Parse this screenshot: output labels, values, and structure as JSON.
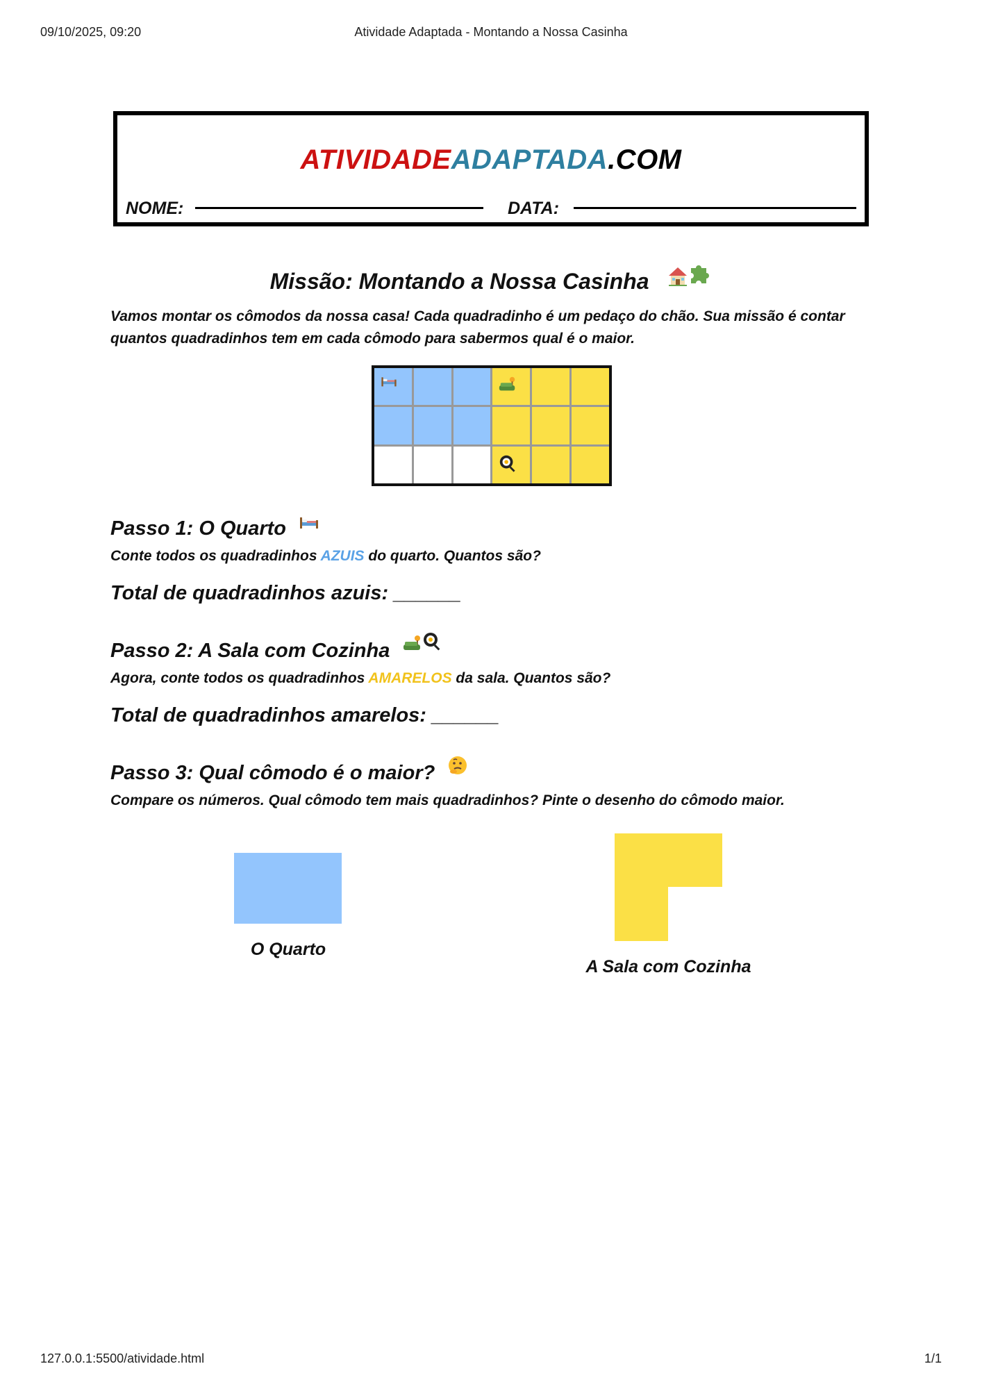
{
  "print_header": {
    "date": "09/10/2025, 09:20",
    "title": "Atividade Adaptada - Montando a Nossa Casinha"
  },
  "print_footer": {
    "url": "127.0.0.1:5500/atividade.html",
    "pages": "1/1"
  },
  "brand": {
    "part1": "ATIVIDADE",
    "part2": "ADAPTADA",
    "part3": ".COM"
  },
  "form": {
    "name_label": "NOME:",
    "date_label": "DATA:"
  },
  "mission": {
    "title": "Missão: Montando a Nossa Casinha",
    "icons": [
      "house-icon",
      "puzzle-icon"
    ],
    "intro": "Vamos montar os cômodos da nossa casa! Cada quadradinho é um pedaço do chão. Sua missão é contar quantos quadradinhos tem em cada cômodo para sabermos qual é o maior."
  },
  "grid": {
    "rows": [
      [
        "blue",
        "blue",
        "blue",
        "yellow",
        "yellow",
        "yellow"
      ],
      [
        "blue",
        "blue",
        "blue",
        "yellow",
        "yellow",
        "yellow"
      ],
      [
        "white",
        "white",
        "white",
        "yellow",
        "yellow",
        "yellow"
      ]
    ],
    "icons": [
      {
        "row": 0,
        "col": 0,
        "icon": "bed-icon"
      },
      {
        "row": 0,
        "col": 3,
        "icon": "couch-lamp-icon"
      },
      {
        "row": 2,
        "col": 3,
        "icon": "frying-pan-icon"
      }
    ]
  },
  "step1": {
    "title": "Passo 1: O Quarto",
    "text_before": "Conte todos os quadradinhos ",
    "keyword": "AZUIS",
    "text_after": " do quarto. Quantos são?",
    "total": "Total de quadradinhos azuis: ______"
  },
  "step2": {
    "title": "Passo 2: A Sala com Cozinha",
    "text_before": "Agora, conte todos os quadradinhos ",
    "keyword": "AMARELOS",
    "text_after": " da sala. Quantos são?",
    "total": "Total de quadradinhos amarelos: ______"
  },
  "step3": {
    "title": "Passo 3: Qual cômodo é o maior?",
    "text": "Compare os números. Qual cômodo tem mais quadradinhos? Pinte o desenho do cômodo maior."
  },
  "rooms": {
    "left_label": "O Quarto",
    "right_label": "A Sala com Cozinha"
  },
  "colors": {
    "blue": "#93c5fd",
    "yellow": "#fbe046",
    "brand_red": "#cc1111",
    "brand_teal": "#2e7fa0"
  }
}
